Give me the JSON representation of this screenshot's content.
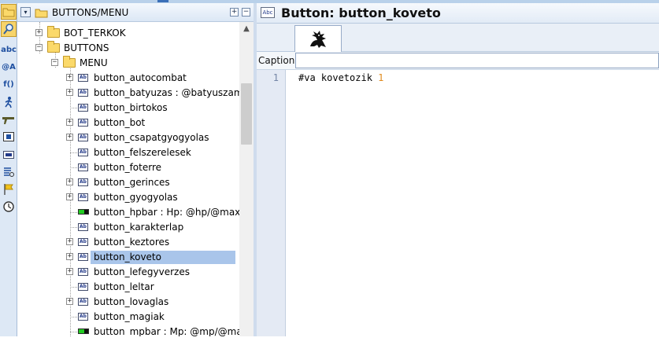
{
  "tree": {
    "header_label": "BUTTONS/MENU",
    "header_collapse_symbol": "▾",
    "header_plus": "+",
    "header_minus": "−",
    "nodes": [
      {
        "label": "BOT_TERKOK",
        "expander": "+"
      },
      {
        "label": "BUTTONS",
        "expander": "−"
      },
      {
        "label": "MENU",
        "expander": "−"
      },
      {
        "label": "button_autocombat",
        "expander": "+",
        "icon": "button-icon"
      },
      {
        "label": "button_batyuzas : @batyuszam",
        "expander": "+",
        "icon": "button-icon"
      },
      {
        "label": "button_birtokos",
        "icon": "button-icon"
      },
      {
        "label": "button_bot",
        "expander": "+",
        "icon": "button-icon"
      },
      {
        "label": "button_csapatgyogyolas",
        "expander": "+",
        "icon": "button-icon"
      },
      {
        "label": "button_felszerelesek",
        "icon": "button-icon"
      },
      {
        "label": "button_foterre",
        "icon": "button-icon"
      },
      {
        "label": "button_gerinces",
        "expander": "+",
        "icon": "button-icon"
      },
      {
        "label": "button_gyogyolas",
        "expander": "+",
        "icon": "button-icon"
      },
      {
        "label": "button_hpbar : Hp: @hp/@maxhp",
        "icon": "gauge-bar-icon"
      },
      {
        "label": "button_karakterlap",
        "icon": "button-icon"
      },
      {
        "label": "button_keztores",
        "expander": "+",
        "icon": "button-icon"
      },
      {
        "label": "button_koveto",
        "expander": "+",
        "icon": "button-icon",
        "selected": true
      },
      {
        "label": "button_lefegyverzes",
        "expander": "+",
        "icon": "button-icon"
      },
      {
        "label": "button_leltar",
        "icon": "button-icon"
      },
      {
        "label": "button_lovaglas",
        "expander": "+",
        "icon": "button-icon"
      },
      {
        "label": "button_magiak",
        "icon": "button-icon"
      },
      {
        "label": "button_mpbar : Mp: @mp/@maxmp",
        "icon": "gauge-bar-icon"
      }
    ],
    "scroll_up_symbol": "▲",
    "icon_text": "Ab"
  },
  "toolbar": {
    "icons": [
      "folder-icon",
      "search-icon",
      "abc-icon",
      "alias-icon",
      "function-icon",
      "runner-icon",
      "gun-icon",
      "button-icon",
      "small-button-icon",
      "list-icon",
      "flag-icon",
      "clock-icon"
    ],
    "glyphs": [
      "",
      "",
      "abc",
      "@A",
      "f()",
      "",
      "",
      "",
      "",
      "",
      "",
      ""
    ]
  },
  "editor": {
    "title": "Button: button_koveto",
    "abc_icon_text": "Abc",
    "caption_label": "Caption:",
    "caption_value": "",
    "line_number": "1",
    "code_text": "#va kovetozik ",
    "code_number": "1"
  },
  "colors": {
    "selection": "#a9c5ea",
    "header_gradient_top": "#f4f8fd",
    "header_gradient_bottom": "#dbe7f5",
    "code_number": "#e08a1e"
  }
}
